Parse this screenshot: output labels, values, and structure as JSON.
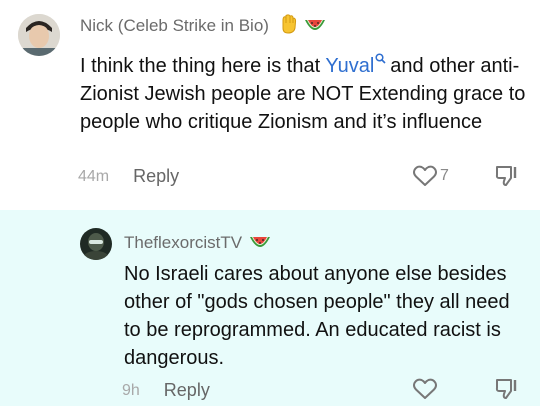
{
  "comments": [
    {
      "username": "Nick (Celeb Strike in Bio)",
      "emojis": [
        "raised-fist-icon",
        "watermelon-icon"
      ],
      "text_before": "I think the thing here is that ",
      "mention": "Yuval",
      "text_after": "and other anti-Zionist Jewish people are NOT Extending grace to people who critique Zionism and it’s influence",
      "time": "44m",
      "reply_label": "Reply",
      "like_count": "7"
    },
    {
      "username": "TheflexorcistTV",
      "emojis": [
        "watermelon-icon"
      ],
      "text": "No Israeli cares about anyone else besides other of \"gods chosen people\" they all need to be reprogrammed. An educated racist is dangerous.",
      "time": "9h",
      "reply_label": "Reply",
      "like_count": ""
    }
  ],
  "colors": {
    "highlight_background": "#e8fcfb",
    "mention": "#2f6fd0",
    "meta_text": "#a8a8a8"
  }
}
